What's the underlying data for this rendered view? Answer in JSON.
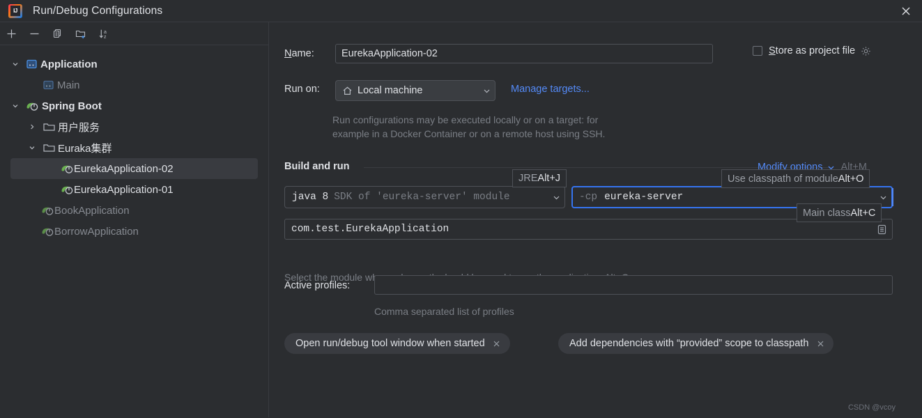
{
  "window": {
    "title": "Run/Debug Configurations",
    "app_icon": "intellij-idea-icon",
    "close_icon": "close-icon"
  },
  "left_toolbar": {
    "buttons": [
      {
        "name": "add-configuration-button",
        "icon": "plus-icon"
      },
      {
        "name": "remove-configuration-button",
        "icon": "minus-icon"
      },
      {
        "name": "copy-configuration-button",
        "icon": "copy-icon"
      },
      {
        "name": "new-folder-button",
        "icon": "new-folder-icon"
      },
      {
        "name": "sort-configurations-button",
        "icon": "sort-alphabetical-icon"
      }
    ]
  },
  "tree": {
    "items": [
      {
        "label": "Application",
        "indent": 0,
        "chevron": "down",
        "icon": "application-icon",
        "style": "bold",
        "selected": false
      },
      {
        "label": "Main",
        "indent": 1,
        "chevron": "none",
        "icon": "application-icon",
        "style": "dim",
        "selected": false
      },
      {
        "label": "Spring Boot",
        "indent": 0,
        "chevron": "down",
        "icon": "spring-boot-icon",
        "style": "bold",
        "selected": false
      },
      {
        "label": "用户服务",
        "indent": 1,
        "chevron": "right",
        "icon": "folder-icon",
        "style": "norm",
        "selected": false
      },
      {
        "label": "Euraka集群",
        "indent": 1,
        "chevron": "down",
        "icon": "folder-icon",
        "style": "norm",
        "selected": false
      },
      {
        "label": "EurekaApplication-02",
        "indent": 2,
        "chevron": "none",
        "icon": "spring-boot-icon",
        "style": "norm",
        "selected": true
      },
      {
        "label": "EurekaApplication-01",
        "indent": 2,
        "chevron": "none",
        "icon": "spring-boot-icon",
        "style": "norm",
        "selected": false
      },
      {
        "label": "BookApplication",
        "indent": 1,
        "chevron": "none",
        "icon": "spring-boot-icon",
        "style": "dim",
        "selected": false
      },
      {
        "label": "BorrowApplication",
        "indent": 1,
        "chevron": "none",
        "icon": "spring-boot-icon",
        "style": "dim",
        "selected": false
      }
    ]
  },
  "form": {
    "name_label_pre": "N",
    "name_label_post": "ame:",
    "name_value": "EurekaApplication-02",
    "store_as_project_file": {
      "checked": false,
      "label_pre": "S",
      "label_post": "tore as project file",
      "gear_icon": "gear-icon"
    },
    "run_on_label": "Run on:",
    "run_on_value": "Local machine",
    "run_on_icon": "home-icon",
    "manage_targets_link": "Manage targets...",
    "run_on_hint_line1": "Run configurations may be executed locally or on a target: for",
    "run_on_hint_line2": "example in a Docker Container or on a remote host using SSH.",
    "build_and_run_title": "Build and run",
    "modify_options_link": "Modify options",
    "modify_options_shortcut": "Alt+M",
    "sdk_value_prefix": "java 8",
    "sdk_value_suffix": "SDK of 'eureka-server' module",
    "classpath_prefix": "-cp",
    "classpath_value": "eureka-server",
    "main_class_value": "com.test.EurekaApplication",
    "main_class_browse_icon": "list-browse-icon",
    "module_hint": "Select the module whose classpath should be used to run the application. Alt+O",
    "active_profiles_label": "Active profiles:",
    "active_profiles_value": "",
    "active_profiles_hint": "Comma separated list of profiles",
    "chips": [
      {
        "label": "Open run/debug tool window when started",
        "close_icon": "close-small-icon"
      },
      {
        "label": "Add dependencies with “provided” scope to classpath",
        "close_icon": "close-small-icon"
      }
    ]
  },
  "tooltips": [
    {
      "name": "jre-tooltip",
      "text": "JRE ",
      "key": "Alt+J"
    },
    {
      "name": "classpath-module-tooltip",
      "text": "Use classpath of module ",
      "key": "Alt+O"
    },
    {
      "name": "main-class-tooltip",
      "text": "Main class ",
      "key": "Alt+C"
    }
  ],
  "watermark": "CSDN @vcoy",
  "colors": {
    "background": "#2b2d30",
    "selection": "#393b40",
    "accent_link": "#548af7",
    "focus_border": "#3574f0",
    "spring_green": "#6aaf50",
    "text": "#dfe1e5",
    "text_dim": "#7a7e85"
  }
}
